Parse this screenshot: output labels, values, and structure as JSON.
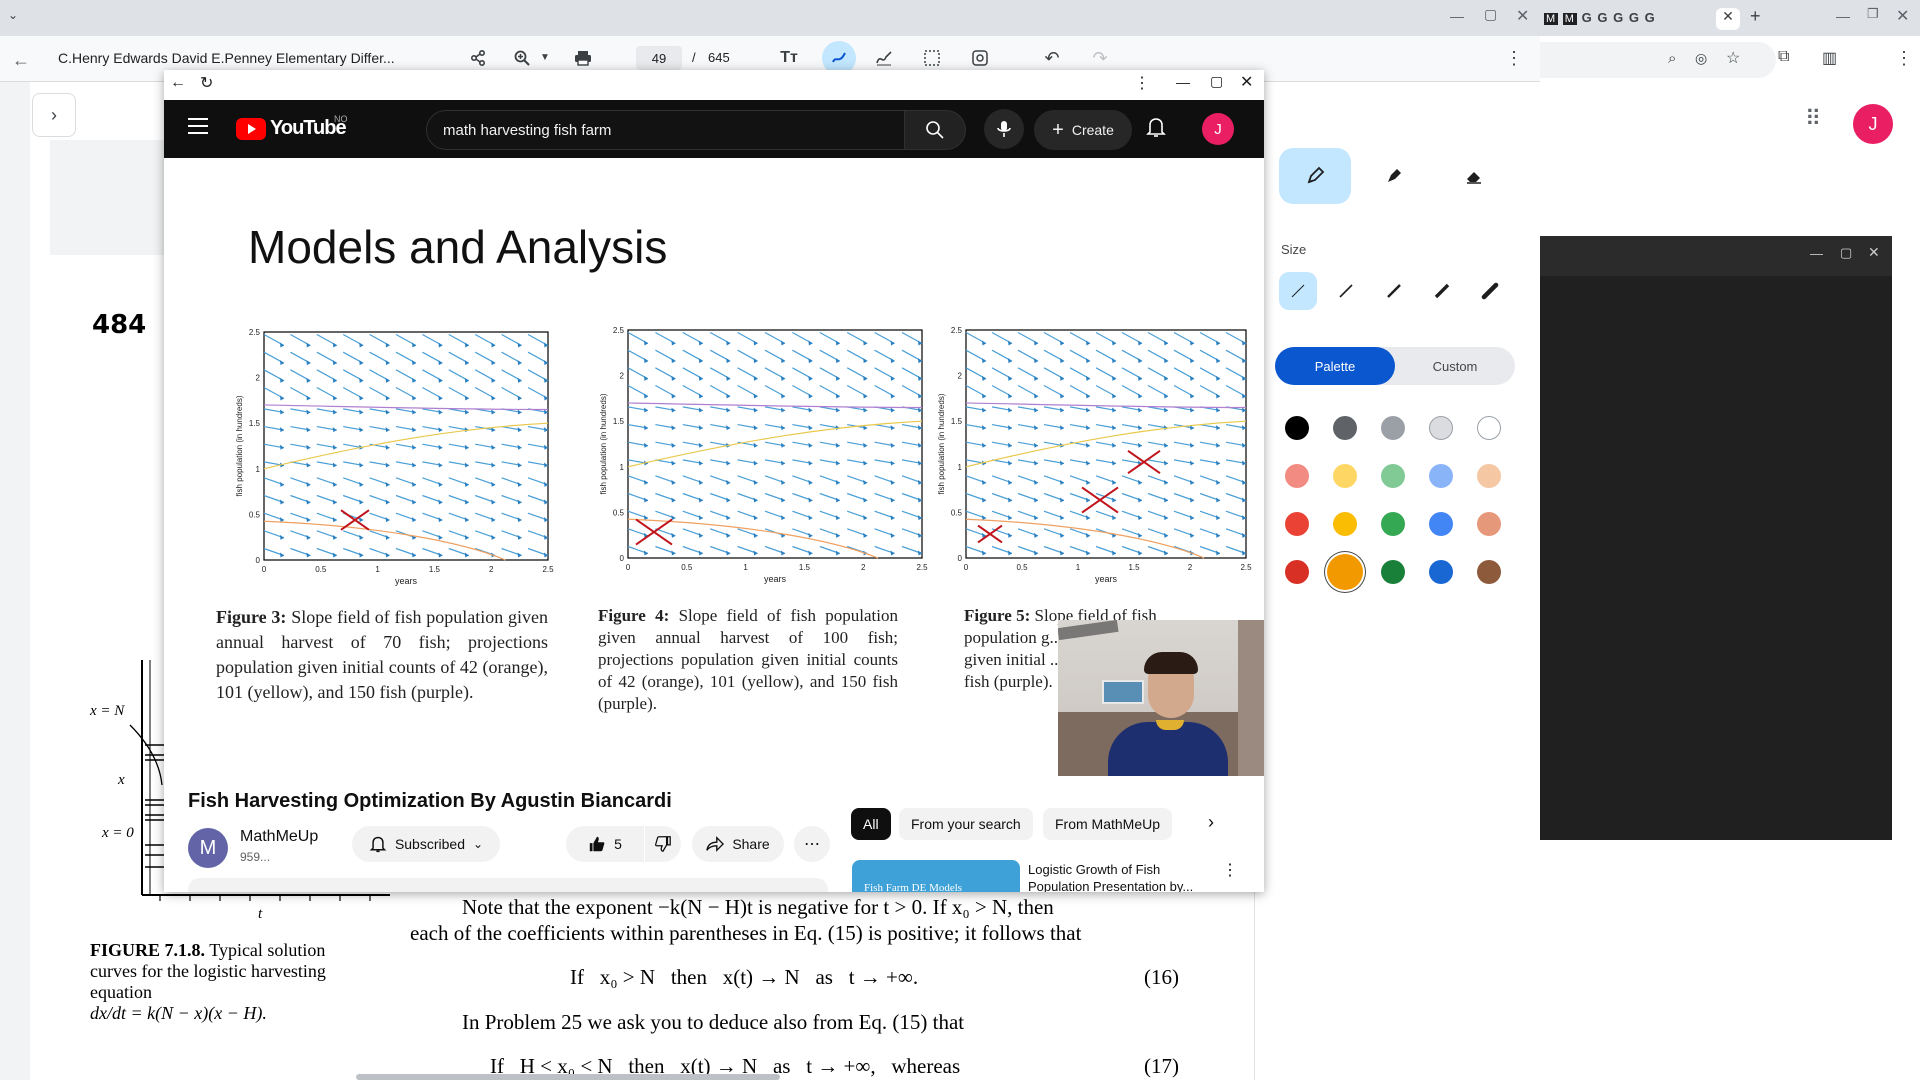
{
  "pdf_viewer": {
    "doc_title": "C.Henry Edwards David E.Penney Elementary Differ...",
    "page_current": "49",
    "page_separator": "/",
    "page_total": "645"
  },
  "book": {
    "page_number": "484",
    "figure_label_a": "x = N",
    "figure_label_b": "x = 0",
    "figure_axis_x": "x",
    "figure_axis_t": "t",
    "figure_caption_title": "FIGURE 7.1.8.",
    "figure_caption_l1": "Typical solution",
    "figure_caption_l2": "curves for the logistic harvesting",
    "figure_caption_l3": "equation",
    "figure_caption_l4": "dx/dt = k(N − x)(x − H).",
    "para1": "Note that the exponent −k(N − H)t is negative for t > 0. If x₀ > N, then",
    "para2": "each of the coefficients within parentheses in Eq. (15) is positive; it follows that",
    "eq16": "If   x₀ > N   then   x(t) → N   as   t → +∞.",
    "eq16_num": "(16)",
    "para3": "In Problem 25 we ask you to deduce also from Eq. (15) that",
    "eq17": "If   H < x₀ < N   then   x(t) → N   as   t → +∞,   whereas",
    "eq17_num": "(17)"
  },
  "draw_panel": {
    "size_label": "Size",
    "tab_palette": "Palette",
    "tab_custom": "Custom",
    "swatches": [
      "#000000",
      "#5f6368",
      "#9aa0a6",
      "#dadce0",
      "#ffffff",
      "#f28b82",
      "#fdd663",
      "#81c995",
      "#8ab4f8",
      "#f6c7a3",
      "#ea4335",
      "#fbbc04",
      "#34a853",
      "#4285f4",
      "#e6987a",
      "#d93025",
      "#f29900",
      "#188038",
      "#1967d2",
      "#8d5a3b"
    ],
    "selected_swatch": "#f29900"
  },
  "chrome2": {
    "avatar_letter": "J",
    "tab_labels": [
      "G",
      "G",
      "G",
      "G",
      "G"
    ]
  },
  "youtube": {
    "brand": "YouTube",
    "region": "NO",
    "search_value": "math harvesting fish farm",
    "create_label": "Create",
    "avatar_letter": "J",
    "slide_title": "Models and Analysis",
    "video_title": "Fish Harvesting Optimization By Agustin Biancardi",
    "channel_name": "MathMeUp",
    "channel_subs": "959...",
    "channel_initial": "M",
    "subscribed_label": "Subscribed",
    "like_count": "5",
    "share_label": "Share",
    "chips": [
      "All",
      "From your search",
      "From MathMeUp"
    ],
    "rec_title": "Logistic Growth of Fish Population Presentation by...",
    "rec_thumb_text": "Fish Farm DE Models"
  },
  "figures": {
    "fig3": {
      "title": "Figure 3:",
      "caption": "Slope field of fish population given annual harvest of 70 fish; projections population given initial counts of 42 (orange), 101 (yellow), and 150 fish (purple)."
    },
    "fig4": {
      "title": "Figure 4:",
      "caption": "Slope field of fish population given annual harvest of 100 fish; projections population given initial counts of 42 (orange), 101 (yellow), and 150 fish (purple)."
    },
    "fig5": {
      "title": "Figure 5:",
      "caption": "Slope field of fish population g... 120 fish; pop... given initial ... (orange), 101 ... fish (purple)."
    },
    "axis_xlabel": "years",
    "axis_ylabel": "fish population (in hundreds)",
    "xticks": [
      "0",
      "0.5",
      "1",
      "1.5",
      "2",
      "2.5"
    ],
    "yticks": [
      "0",
      "0.5",
      "1",
      "1.5",
      "2",
      "2.5"
    ]
  }
}
